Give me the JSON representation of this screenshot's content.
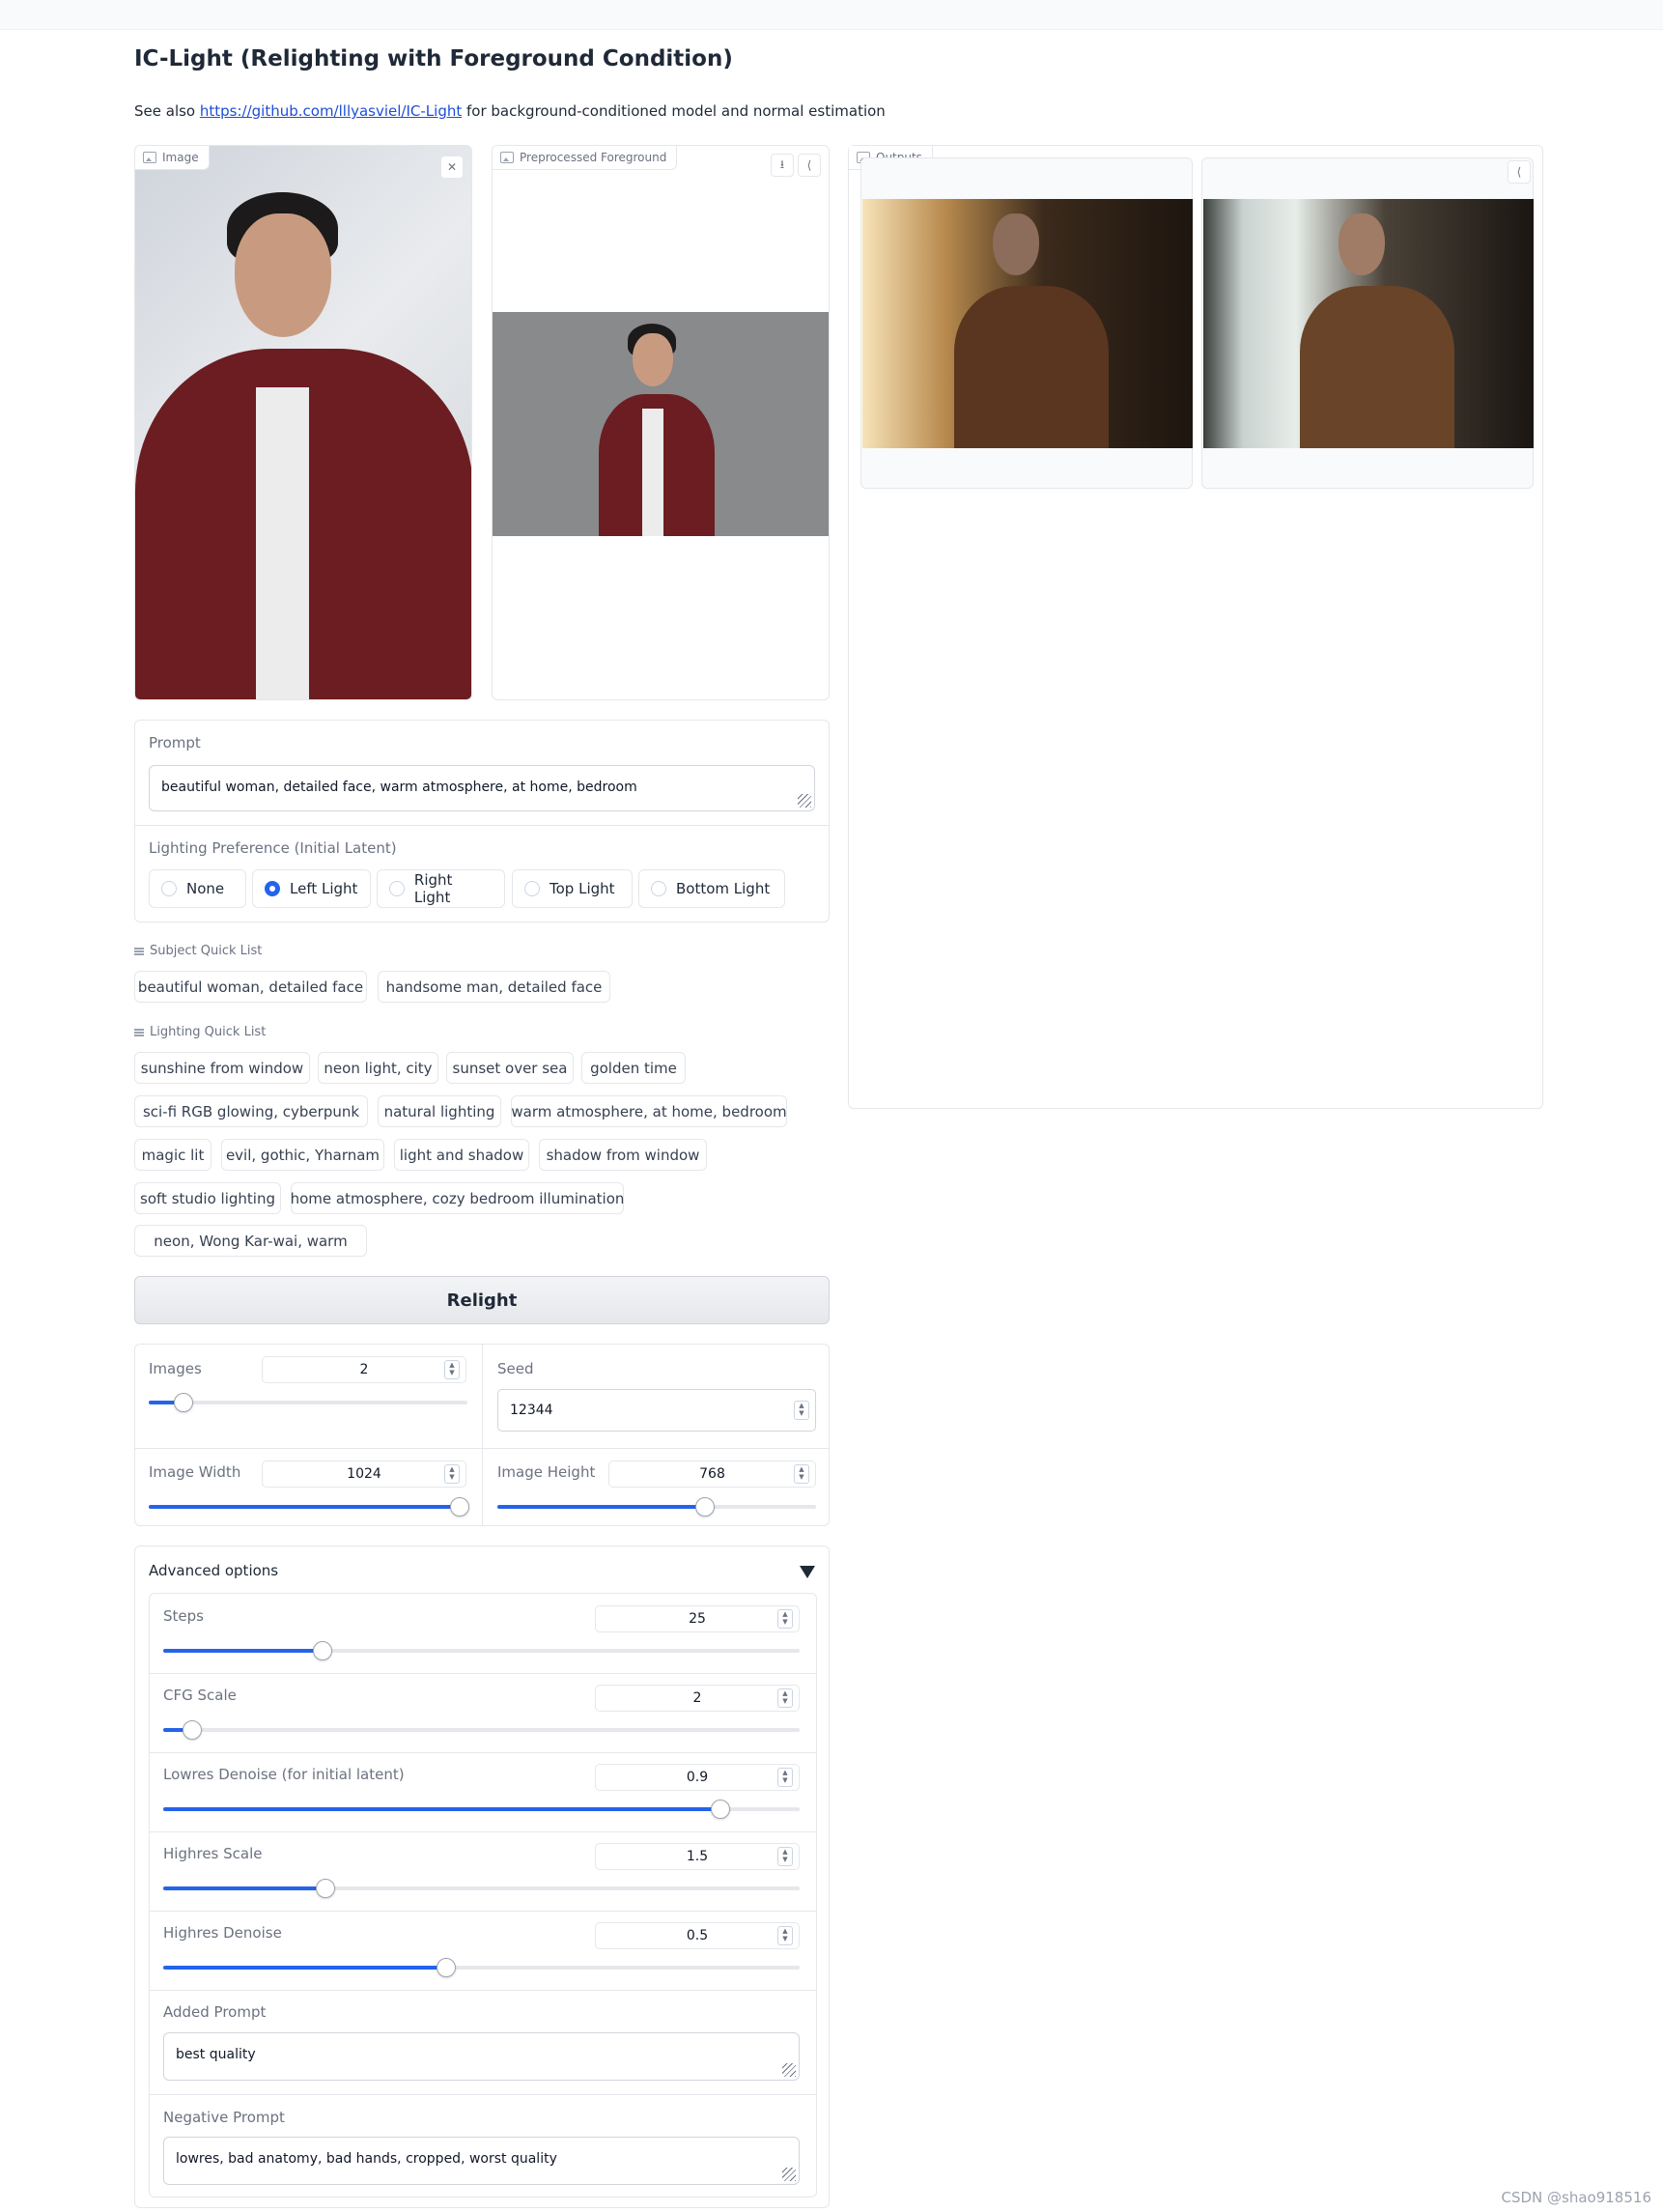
{
  "header": {
    "title": "IC-Light (Relighting with Foreground Condition)",
    "subtitle_prefix": "See also ",
    "subtitle_link": "https://github.com/lllyasviel/IC-Light",
    "subtitle_suffix": " for background-conditioned model and normal estimation"
  },
  "image_panel": {
    "label": "Image"
  },
  "preprocessed_panel": {
    "label": "Preprocessed Foreground"
  },
  "outputs_panel": {
    "label": "Outputs"
  },
  "prompt": {
    "label": "Prompt",
    "value": "beautiful woman, detailed face, warm atmosphere, at home, bedroom"
  },
  "lighting": {
    "label": "Lighting Preference (Initial Latent)",
    "options": [
      "None",
      "Left Light",
      "Right Light",
      "Top Light",
      "Bottom Light"
    ],
    "selected": "Left Light"
  },
  "subject_quick_list": {
    "title": "Subject Quick List",
    "items": [
      "beautiful woman, detailed face",
      "handsome man, detailed face"
    ]
  },
  "lighting_quick_list": {
    "title": "Lighting Quick List",
    "items": [
      "sunshine from window",
      "neon light, city",
      "sunset over sea",
      "golden time",
      "sci-fi RGB glowing, cyberpunk",
      "natural lighting",
      "warm atmosphere, at home, bedroom",
      "magic lit",
      "evil, gothic, Yharnam",
      "light and shadow",
      "shadow from window",
      "soft studio lighting",
      "home atmosphere, cozy bedroom illumination",
      "neon, Wong Kar-wai, warm"
    ]
  },
  "relight_button": "Relight",
  "settings": {
    "images": {
      "label": "Images",
      "value": "2",
      "fraction": 0.11
    },
    "seed": {
      "label": "Seed",
      "value": "12344"
    },
    "image_width": {
      "label": "Image Width",
      "value": "1024",
      "fraction": 0.975
    },
    "image_height": {
      "label": "Image Height",
      "value": "768",
      "fraction": 0.65
    }
  },
  "advanced": {
    "title": "Advanced options",
    "toggle_icon": "triangle-down-icon",
    "steps": {
      "label": "Steps",
      "value": "25",
      "fraction": 0.25
    },
    "cfg_scale": {
      "label": "CFG Scale",
      "value": "2",
      "fraction": 0.045
    },
    "lowres_denoise": {
      "label": "Lowres Denoise (for initial latent)",
      "value": "0.9",
      "fraction": 0.875
    },
    "highres_scale": {
      "label": "Highres Scale",
      "value": "1.5",
      "fraction": 0.255
    },
    "highres_denoise": {
      "label": "Highres Denoise",
      "value": "0.5",
      "fraction": 0.445
    },
    "added_prompt": {
      "label": "Added Prompt",
      "value": "best quality"
    },
    "negative_prompt": {
      "label": "Negative Prompt",
      "value": "lowres, bad anatomy, bad hands, cropped, worst quality"
    }
  },
  "watermark": "CSDN @shao918516",
  "colors": {
    "accent": "#2563eb",
    "border": "#e5e7eb",
    "text": "#1f2937"
  }
}
